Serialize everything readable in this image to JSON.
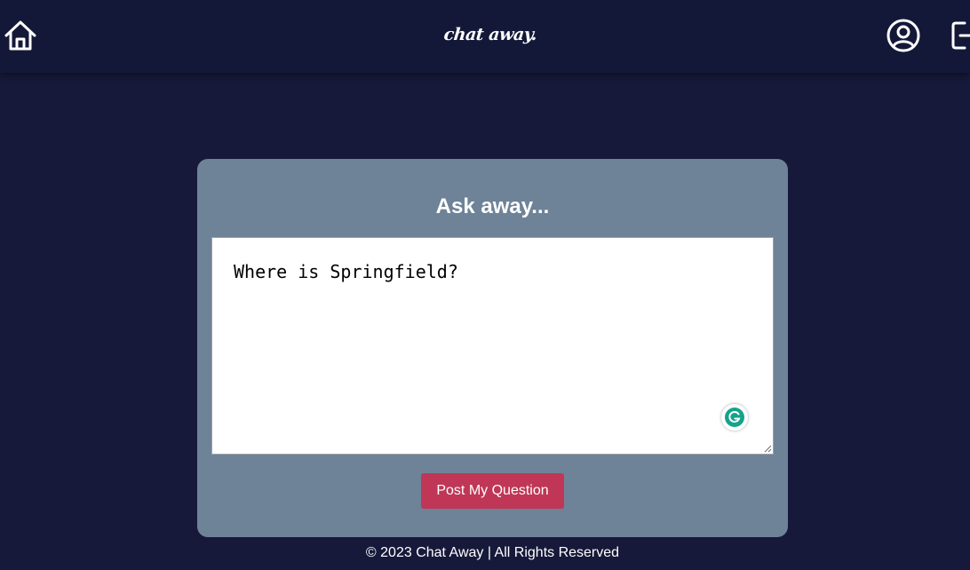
{
  "navbar": {
    "brand": "chat away.",
    "home_icon": "home-icon",
    "profile_icon": "user-circle-icon",
    "logout_icon": "logout-icon"
  },
  "card": {
    "title": "Ask away...",
    "question_value": "Where is Springfield?",
    "submit_label": "Post My Question",
    "grammarly_icon": "grammarly-icon"
  },
  "footer": {
    "text": "© 2023 Chat Away | All Rights Reserved"
  },
  "colors": {
    "page_background": "#17193a",
    "navbar_background": "#141838",
    "card_background": "#6e8398",
    "button_background": "#c03656",
    "grammarly": "#15a38a"
  }
}
